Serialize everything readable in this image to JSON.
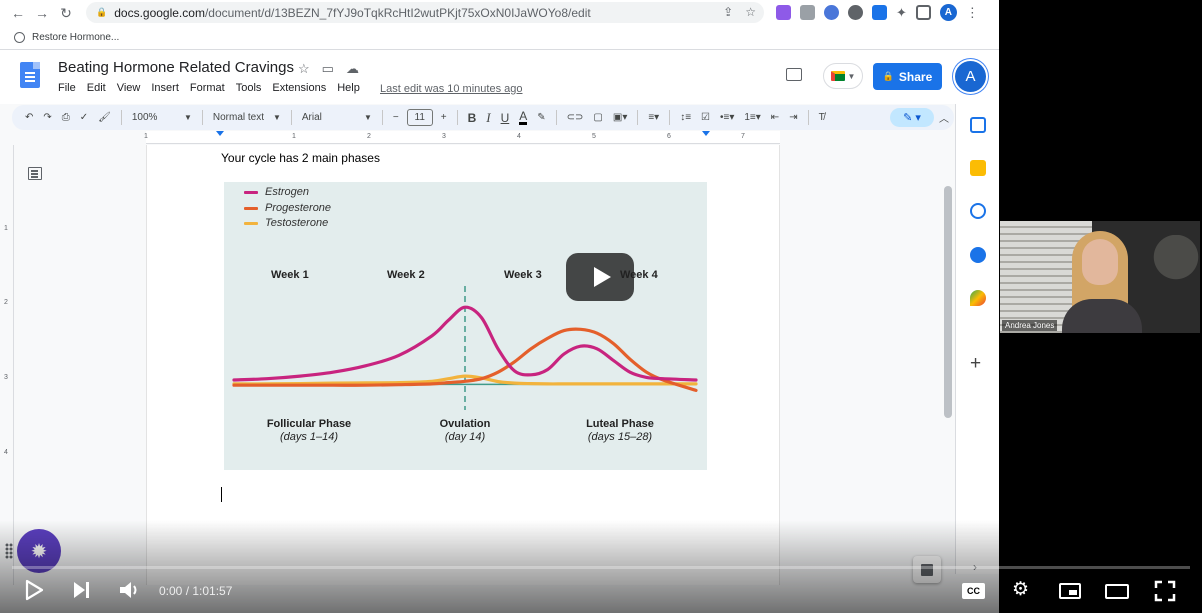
{
  "browser": {
    "url_domain": "docs.google.com",
    "url_path": "/document/d/13BEZN_7fYJ9oTqkRcHtI2wutPKjt75xOxN0IJaWOYo8/edit",
    "bookmark": "Restore Hormone...",
    "profile_initial": "A"
  },
  "doc": {
    "title": "Beating Hormone Related Cravings",
    "menu": [
      "File",
      "Edit",
      "View",
      "Insert",
      "Format",
      "Tools",
      "Extensions",
      "Help"
    ],
    "last_edit": "Last edit was 10 minutes ago",
    "share_label": "Share",
    "user_initial": "A"
  },
  "toolbar": {
    "zoom": "100%",
    "style": "Normal text",
    "font": "Arial",
    "font_size": "11",
    "bold": "B",
    "italic": "I",
    "underline": "U",
    "text_color": "A"
  },
  "ruler": {
    "numbers": [
      "1",
      "1",
      "2",
      "3",
      "4",
      "5",
      "6",
      "7"
    ],
    "vertical_numbers": [
      "1",
      "2",
      "3",
      "4"
    ]
  },
  "content": {
    "intro": "Your cycle has 2 main phases"
  },
  "chart_data": {
    "type": "line",
    "legend": [
      {
        "label": "Estrogen",
        "color": "#c8247f"
      },
      {
        "label": "Progesterone",
        "color": "#e45f2b"
      },
      {
        "label": "Testosterone",
        "color": "#f2b33d"
      }
    ],
    "weeks": [
      "Week 1",
      "Week 2",
      "Week 3",
      "Week 4"
    ],
    "phases": [
      {
        "name": "Follicular Phase",
        "days": "(days 1–14)"
      },
      {
        "name": "Ovulation",
        "days": "(day 14)"
      },
      {
        "name": "Luteal Phase",
        "days": "(days 15–28)"
      }
    ],
    "x": [
      0,
      2,
      4,
      6,
      8,
      10,
      12,
      13,
      14,
      15,
      16,
      17,
      18,
      19,
      20,
      21,
      22,
      23,
      24,
      25,
      26,
      28
    ],
    "series": [
      {
        "name": "Estrogen",
        "values": [
          10,
          10.5,
          11.5,
          13,
          15.5,
          19.5,
          27,
          33,
          38,
          34,
          22,
          13.5,
          12,
          14,
          20,
          23,
          22,
          17.5,
          13,
          11,
          10.5,
          10
        ]
      },
      {
        "name": "Progesterone",
        "values": [
          8,
          8,
          8,
          8,
          8,
          8.2,
          8.5,
          9,
          9.5,
          10.5,
          13,
          17,
          22,
          26,
          29,
          29.5,
          28,
          24,
          18,
          13,
          10,
          6
        ]
      },
      {
        "name": "Testosterone",
        "values": [
          8.5,
          8.5,
          8.6,
          8.8,
          8.9,
          9,
          9.5,
          10.5,
          11.5,
          10.8,
          9.4,
          8.8,
          8.6,
          8.5,
          8.5,
          8.5,
          8.5,
          8.5,
          8.5,
          8.5,
          8.5,
          8.5
        ]
      }
    ],
    "ovulation_day": 14,
    "xlim": [
      0,
      28
    ],
    "ylim": [
      0,
      45
    ]
  },
  "webcam": {
    "name": "Andrea Jones"
  },
  "player": {
    "time": "0:00 / 1:01:57",
    "cc": "CC"
  }
}
